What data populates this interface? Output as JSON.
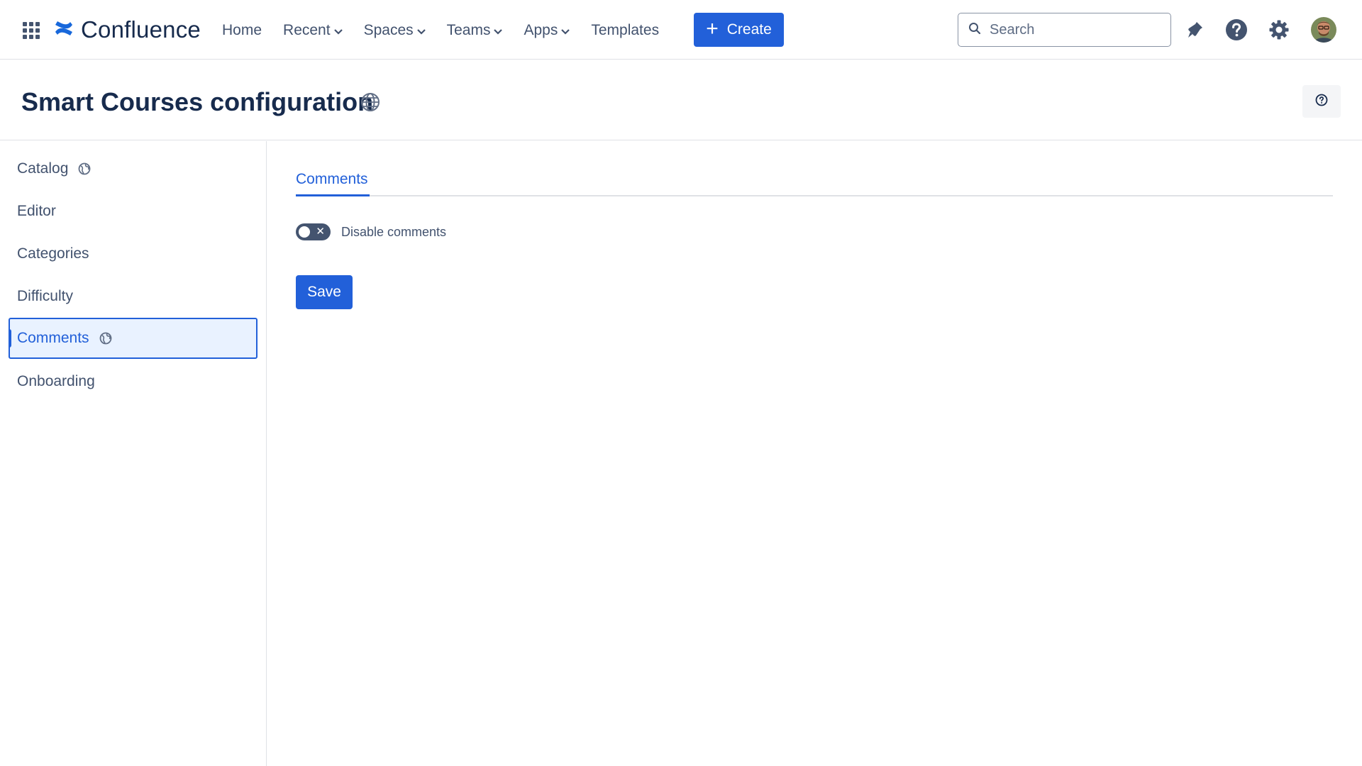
{
  "topnav": {
    "logo_text": "Confluence",
    "items": [
      {
        "label": "Home",
        "dropdown": false
      },
      {
        "label": "Recent",
        "dropdown": true
      },
      {
        "label": "Spaces",
        "dropdown": true
      },
      {
        "label": "Teams",
        "dropdown": true
      },
      {
        "label": "Apps",
        "dropdown": true
      },
      {
        "label": "Templates",
        "dropdown": false
      }
    ],
    "create_label": "Create",
    "search_placeholder": "Search",
    "icons": [
      "notifications-icon",
      "help-icon",
      "settings-icon"
    ]
  },
  "page": {
    "title": "Smart Courses configuration"
  },
  "sidebar": {
    "items": [
      {
        "label": "Catalog",
        "globe": true,
        "active": false
      },
      {
        "label": "Editor",
        "globe": false,
        "active": false
      },
      {
        "label": "Categories",
        "globe": false,
        "active": false
      },
      {
        "label": "Difficulty",
        "globe": false,
        "active": false
      },
      {
        "label": "Comments",
        "globe": true,
        "active": true
      },
      {
        "label": "Onboarding",
        "globe": false,
        "active": false
      }
    ]
  },
  "main": {
    "tab_label": "Comments",
    "toggle_label": "Disable comments",
    "toggle_on": false,
    "save_label": "Save"
  },
  "colors": {
    "accent": "#2260d9",
    "text": "#172b4d",
    "subtle_text": "#42526e",
    "active_bg": "#e9f2ff"
  }
}
